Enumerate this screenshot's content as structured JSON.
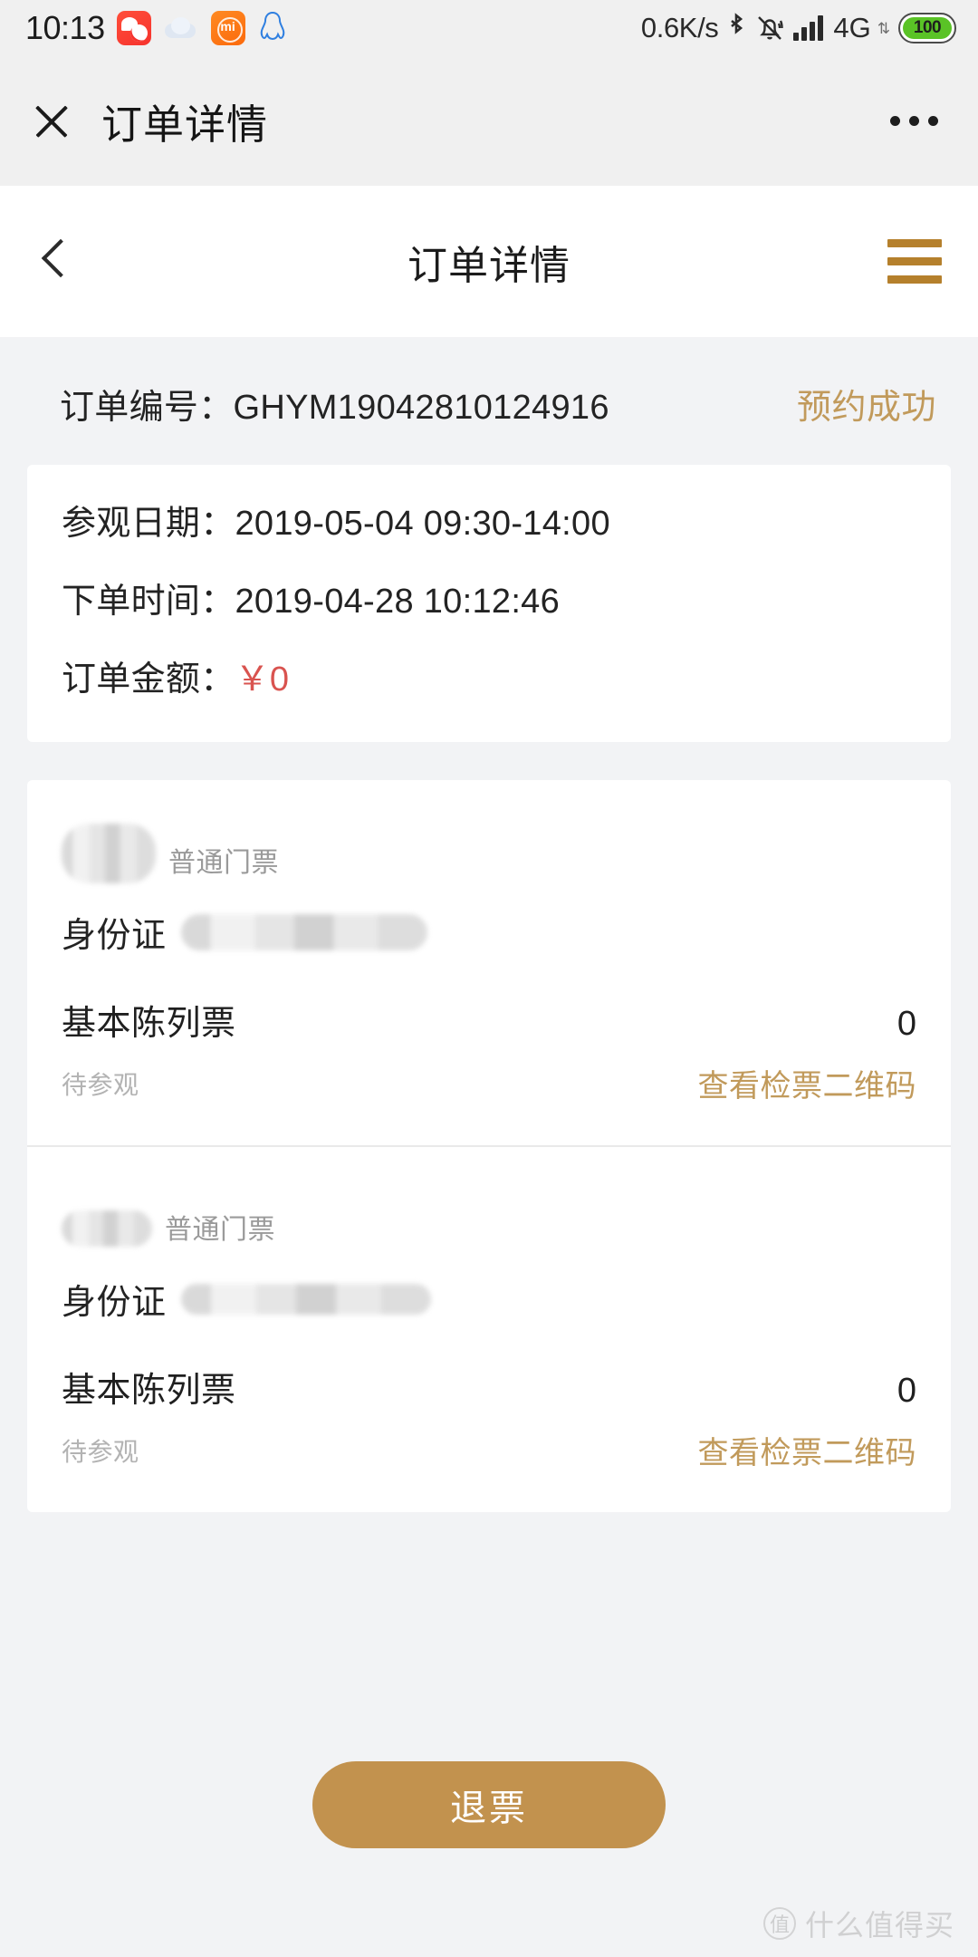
{
  "status_bar": {
    "time": "10:13",
    "network_speed": "0.6K/s",
    "network_type": "4G",
    "battery_level": "100",
    "icons": [
      "chat-app-icon",
      "cloud-weather-icon",
      "mi-app-icon",
      "qq-app-icon",
      "bluetooth-icon",
      "mute-bell-icon",
      "signal-bars-icon",
      "data-arrows-icon",
      "battery-icon"
    ],
    "mi_label": "mi"
  },
  "wechat_header": {
    "title": "订单详情",
    "close_icon": "close-icon",
    "more_icon": "more-options-icon"
  },
  "app_nav": {
    "title": "订单详情",
    "back_icon": "chevron-left-icon",
    "menu_icon": "hamburger-menu-icon",
    "accent_color": "#b5802c"
  },
  "order": {
    "number_label": "订单编号：",
    "number": "GHYM19042810124916",
    "number_full": "订单编号：GHYM19042810124916",
    "status": "预约成功",
    "status_color": "#c19a5b",
    "visit_date": "参观日期：2019-05-04 09:30-14:00",
    "order_time": "下单时间：2019-04-28 10:12:46",
    "amount_label": "订单金额：",
    "amount": "￥0",
    "amount_color": "#d9534f"
  },
  "tickets": [
    {
      "holder_name": "",
      "ticket_type": "普通门票",
      "id_label": "身份证",
      "id_number": "",
      "ticket_name": "基本陈列票",
      "count": "0",
      "state": "待参观",
      "qr_link": "查看检票二维码"
    },
    {
      "holder_name": "",
      "ticket_type": "普通门票",
      "id_label": "身份证",
      "id_number": "",
      "ticket_name": "基本陈列票",
      "count": "0",
      "state": "待参观",
      "qr_link": "查看检票二维码"
    }
  ],
  "footer": {
    "refund_label": "退票",
    "refund_color": "#c2924e"
  },
  "watermark": {
    "badge": "值",
    "text": "什么值得买"
  }
}
